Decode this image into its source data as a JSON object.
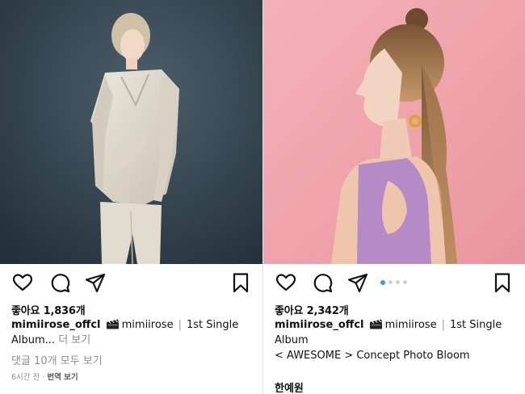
{
  "posts": [
    {
      "photo_description": "portrait-white-suit",
      "likes": "좋아요 1,836개",
      "username": "mimiirose_offcl",
      "emoji": "clapper-board-icon",
      "mention": "mimiirose",
      "caption_start": "1st Single",
      "caption_line2": "Album...",
      "more": "더 보기",
      "comments_link": "댓글 10개 모두 보기",
      "time": "6시간 전",
      "meta_sep": "·",
      "translate": "번역 보기"
    },
    {
      "photo_description": "portrait-pink-background",
      "likes": "좋아요 2,342개",
      "username": "mimiirose_offcl",
      "emoji": "clapper-board-icon",
      "mention": "mimiirose",
      "caption_start": "1st Single",
      "caption_line2": "Album",
      "caption_line3": "< AWESOME > Concept Photo Bloom",
      "commenter": "한예원",
      "carousel_dots": 4,
      "carousel_active": 0
    }
  ],
  "colors": {
    "accent": "#3897f0",
    "muted": "#8e8e8e",
    "dark_bg": "#2e3b45",
    "pink_bg": "#f0a6ad"
  }
}
